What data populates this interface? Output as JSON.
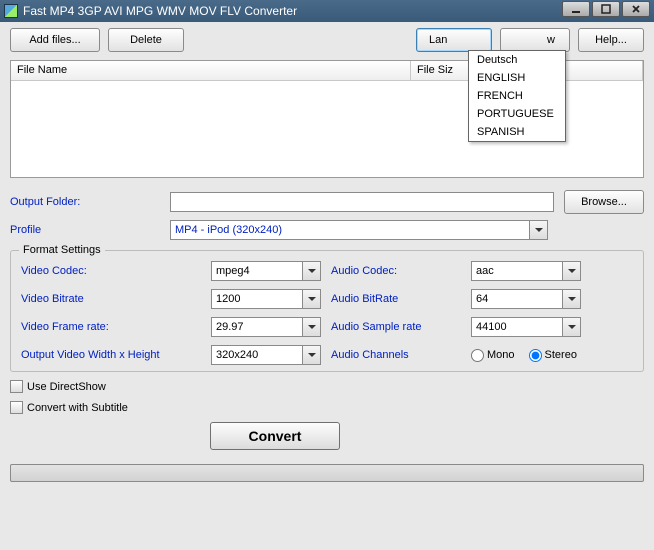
{
  "window": {
    "title": "Fast MP4 3GP AVI MPG WMV MOV FLV Converter"
  },
  "toolbar": {
    "add_files": "Add files...",
    "delete": "Delete",
    "language_partial": "Lan",
    "view_partial": "w",
    "help": "Help..."
  },
  "table": {
    "col_filename": "File Name",
    "col_filesize": "File Siz"
  },
  "output": {
    "folder_label": "Output Folder:",
    "folder_value": "",
    "browse": "Browse...",
    "profile_label": "Profile",
    "profile_value": "MP4 - iPod (320x240)"
  },
  "format": {
    "legend": "Format Settings",
    "video_codec_label": "Video Codec:",
    "video_codec": "mpeg4",
    "video_bitrate_label": "Video Bitrate",
    "video_bitrate": "1200",
    "video_frame_rate_label": "Video Frame rate:",
    "video_frame_rate": "29.97",
    "output_wh_label": "Output Video Width x Height",
    "output_wh": "320x240",
    "audio_codec_label": "Audio Codec:",
    "audio_codec": "aac",
    "audio_bitrate_label": "Audio BitRate",
    "audio_bitrate": "64",
    "audio_sample_label": "Audio Sample rate",
    "audio_sample": "44100",
    "audio_channels_label": "Audio Channels",
    "mono": "Mono",
    "stereo": "Stereo",
    "channels_selected": "stereo"
  },
  "options": {
    "use_directshow": "Use DirectShow",
    "convert_subtitle": "Convert with Subtitle"
  },
  "convert": "Convert",
  "lang_menu": [
    "Deutsch",
    "ENGLISH",
    "FRENCH",
    "PORTUGUESE",
    "SPANISH"
  ]
}
